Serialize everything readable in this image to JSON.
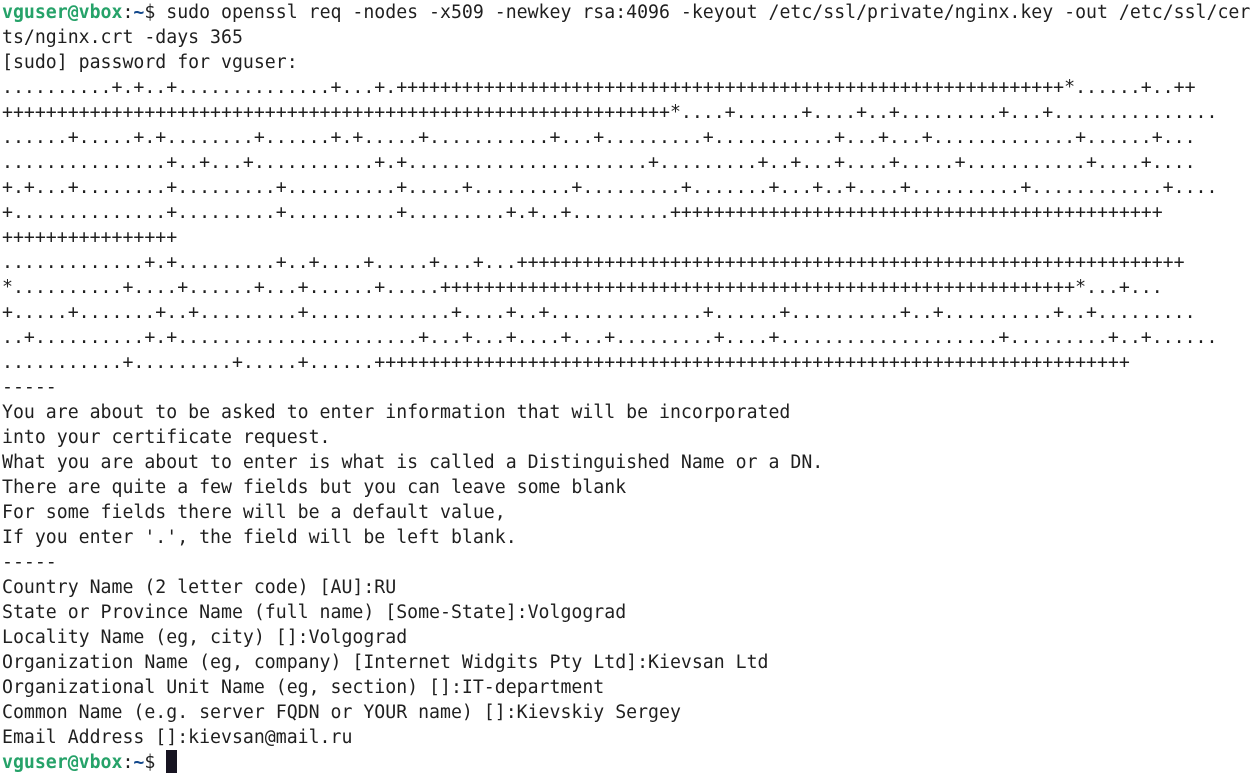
{
  "terminal": {
    "prompt_user_host": "vguser@vbox",
    "prompt_sep": ":",
    "prompt_path": "~",
    "prompt_symbol": "$ ",
    "command_line_1": "sudo openssl req -nodes -x509 -newkey rsa:4096 -keyout /etc/ssl/private/nginx.key -out /etc/ssl/cer",
    "lines": [
      "ts/nginx.crt -days 365",
      "[sudo] password for vguser:",
      "..........+.+..+..............+...+.+++++++++++++++++++++++++++++++++++++++++++++++++++++++++++++*......+..++",
      "+++++++++++++++++++++++++++++++++++++++++++++++++++++++++++++*....+......+....+..+.........+...+...............",
      "......+.....+.+........+......+.+.....+...........+...+.........+...........+...+...+.............+......+...",
      "...............+..+...+...........+.+......................+.........+..+...+....+.....+...........+....+....",
      "+.+...+........+.........+..........+.....+.........+.........+.......+...+..+....+..........+............+....",
      "+..............+.........+..........+.........+.+..+.........+++++++++++++++++++++++++++++++++++++++++++++",
      "++++++++++++++++",
      ".............+.+.........+..+....+.....+...+...+++++++++++++++++++++++++++++++++++++++++++++++++++++++++++++",
      "*..........+....+......+...+......+.....++++++++++++++++++++++++++++++++++++++++++++++++++++++++++*...+...",
      "+.....+.......+..+.........+.............+....+..+..............+......+..........+..+..........+..+.........",
      "..+..........+.+......................+...+...+....+...+.........+....+....................+.........+..+......",
      "...........+.........+.....+......+++++++++++++++++++++++++++++++++++++++++++++++++++++++++++++++++++++",
      "-----",
      "You are about to be asked to enter information that will be incorporated",
      "into your certificate request.",
      "What you are about to enter is what is called a Distinguished Name or a DN.",
      "There are quite a few fields but you can leave some blank",
      "For some fields there will be a default value,",
      "If you enter '.', the field will be left blank.",
      "-----",
      "Country Name (2 letter code) [AU]:RU",
      "State or Province Name (full name) [Some-State]:Volgograd",
      "Locality Name (eg, city) []:Volgograd",
      "Organization Name (eg, company) [Internet Widgits Pty Ltd]:Kievsan Ltd",
      "Organizational Unit Name (eg, section) []:IT-department",
      "Common Name (e.g. server FQDN or YOUR name) []:Kievskiy Sergey",
      "Email Address []:kievsan@mail.ru"
    ],
    "colors": {
      "background": "#ffffff",
      "text": "#1f1f1f",
      "prompt_user": "#26a269",
      "prompt_path": "#12488b",
      "cursor": "#171421"
    }
  }
}
